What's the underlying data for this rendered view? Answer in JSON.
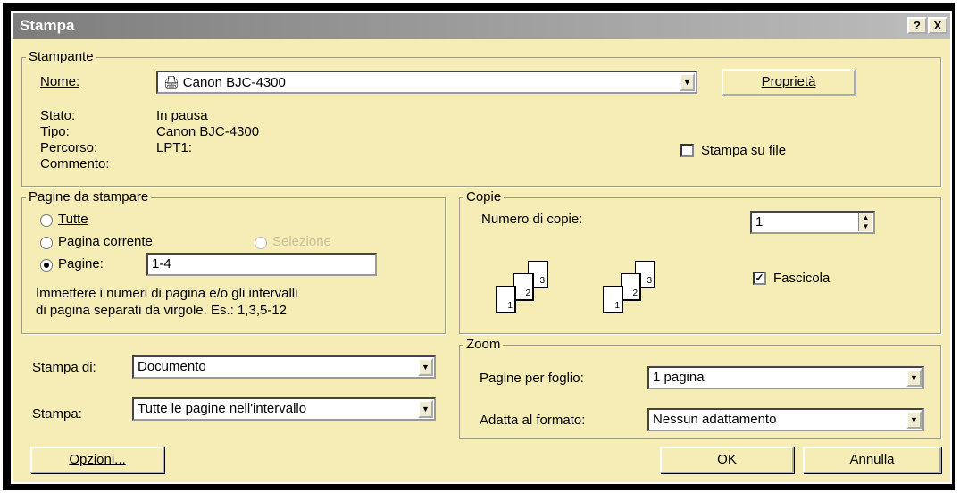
{
  "window": {
    "title": "Stampa",
    "help_btn": "?",
    "close_btn": "X"
  },
  "printer": {
    "group": "Stampante",
    "name_label": "Nome:",
    "name_value": "Canon BJC-4300",
    "properties_btn": "Proprietà",
    "status_label": "Stato:",
    "status_value": "In pausa",
    "type_label": "Tipo:",
    "type_value": "Canon BJC-4300",
    "path_label": "Percorso:",
    "path_value": "LPT1:",
    "comment_label": "Commento:",
    "print_to_file": "Stampa su file",
    "print_to_file_checked": false
  },
  "pages": {
    "group": "Pagine da stampare",
    "all": "Tutte",
    "current": "Pagina corrente",
    "selection": "Selezione",
    "pages_label": "Pagine:",
    "pages_value": "1-4",
    "selected": "pages",
    "hint_line1": "Immettere i numeri di pagina e/o gli intervalli",
    "hint_line2": "di pagina separati da virgole. Es.: 1,3,5-12"
  },
  "copies": {
    "group": "Copie",
    "count_label": "Numero di copie:",
    "count_value": "1",
    "collate": "Fascicola",
    "collate_checked": true,
    "page_numbers": [
      "1",
      "2",
      "3"
    ]
  },
  "print_what": {
    "label": "Stampa di:",
    "value": "Documento"
  },
  "print_range": {
    "label": "Stampa:",
    "value": "Tutte le pagine nell'intervallo"
  },
  "zoom": {
    "group": "Zoom",
    "pages_per_sheet_label": "Pagine per foglio:",
    "pages_per_sheet_value": "1 pagina",
    "fit_label": "Adatta al formato:",
    "fit_value": "Nessun adattamento"
  },
  "buttons": {
    "options": "Opzioni...",
    "ok": "OK",
    "cancel": "Annulla"
  }
}
